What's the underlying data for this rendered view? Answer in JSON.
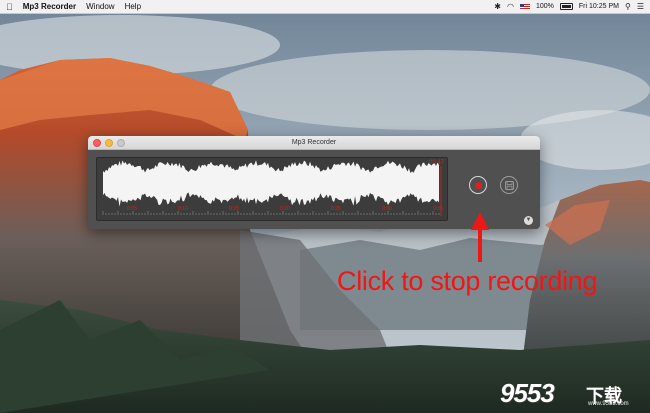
{
  "menubar": {
    "apple_icon": "",
    "app_name": "Mp3 Recorder",
    "menus": [
      "Window",
      "Help"
    ],
    "status": {
      "icons": [
        "bluetooth-icon",
        "wifi-icon",
        "flag-us-icon",
        "battery-icon",
        "search-icon",
        "list-icon"
      ],
      "battery_percent": "100%",
      "clock": "Fri 10:25 PM"
    }
  },
  "window": {
    "title": "Mp3 Recorder",
    "timer": "00:47",
    "markers": [
      "0:05",
      "0:10",
      "0:15",
      "0:20",
      "0:25",
      "0:30",
      "0:35"
    ],
    "buttons": {
      "record": "stop-recording-button",
      "save": "save-button",
      "menu": "options-menu-button"
    },
    "colors": {
      "accent": "#e02020",
      "panel": "#3c3c3c"
    }
  },
  "annotation": {
    "text": "Click to stop recording",
    "color": "#ef1616"
  },
  "watermark": {
    "text": "9553",
    "cn": "下载",
    "url": "www.9553.com"
  }
}
